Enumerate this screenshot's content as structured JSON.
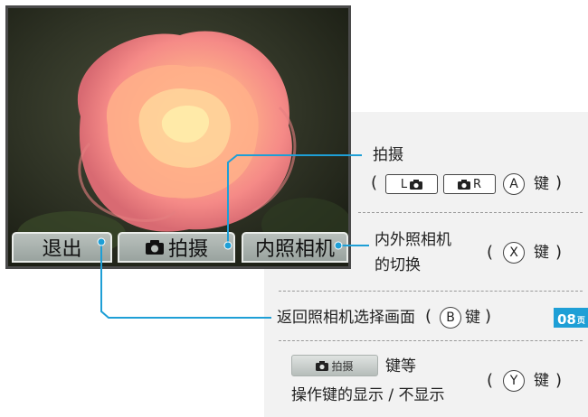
{
  "screen": {
    "buttons": {
      "exit_label": "退出",
      "shoot_label": "拍摄",
      "switch_label": "内照相机"
    }
  },
  "callouts": {
    "shoot": {
      "label": "拍摄",
      "paren_open": "(",
      "paren_close": ")",
      "key_l_letter": "L",
      "key_r_letter": "R",
      "button_letter": "A",
      "key_suffix": "键"
    },
    "switch_camera": {
      "line1": "内外照相机",
      "line2": "的切换",
      "paren_open": "(",
      "paren_close": ")",
      "button_letter": "X",
      "key_suffix": "键"
    },
    "return": {
      "label": "返回照相机选择画面",
      "paren_open": "(",
      "paren_close": ")",
      "button_letter": "B",
      "key_suffix": "键",
      "page_number": "08",
      "page_unit": "页"
    },
    "toggle_display": {
      "mini_button_label": "拍摄",
      "line1_suffix": "键等",
      "line2": "操作键的显示 / 不显示",
      "paren_open": "(",
      "paren_close": ")",
      "button_letter": "Y",
      "key_suffix": "键"
    }
  },
  "colors": {
    "leader_line": "#1e9fd6",
    "page_badge": "#1e9fd6",
    "panel_bg": "#f2f2f2"
  }
}
